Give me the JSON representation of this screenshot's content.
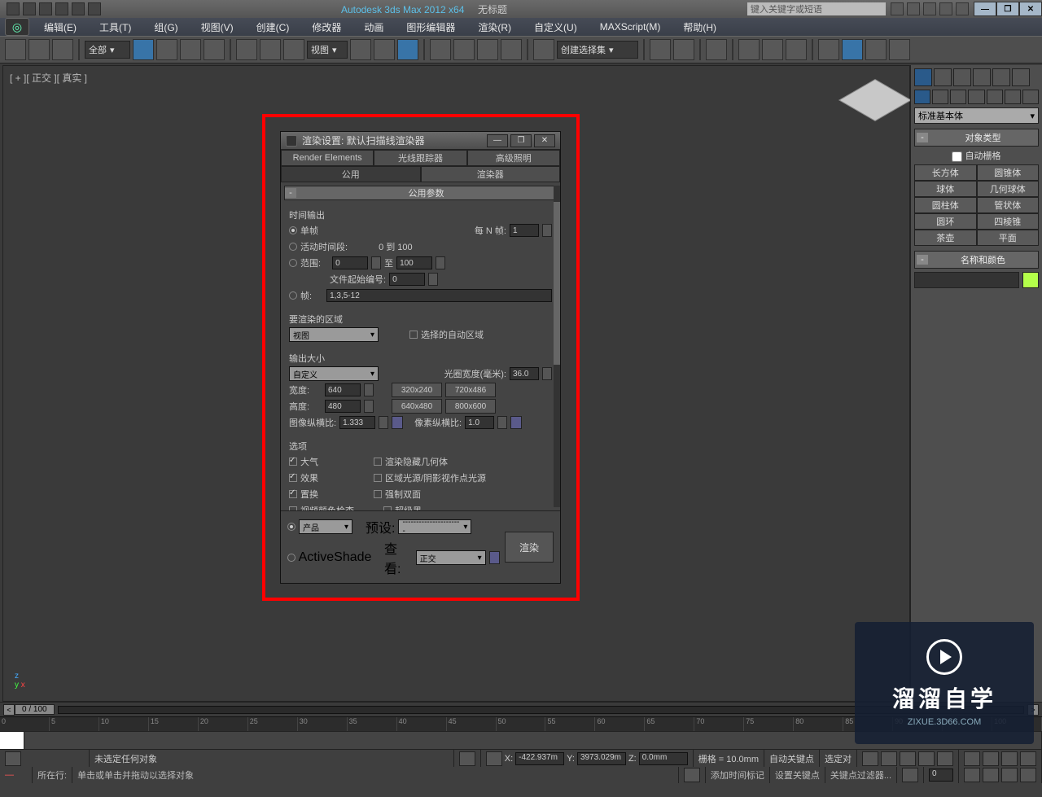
{
  "app": {
    "title_left": "Autodesk 3ds Max 2012 x64",
    "title_right": "无标题",
    "search_placeholder": "键入关键字或短语"
  },
  "menu": {
    "edit": "编辑(E)",
    "tools": "工具(T)",
    "group": "组(G)",
    "views": "视图(V)",
    "create": "创建(C)",
    "modifiers": "修改器",
    "animation": "动画",
    "graph": "图形编辑器",
    "rendering": "渲染(R)",
    "customize": "自定义(U)",
    "maxscript": "MAXScript(M)",
    "help": "帮助(H)"
  },
  "toolbar": {
    "filter_combo": "全部",
    "view_combo": "视图",
    "selset_combo": "创建选择集"
  },
  "viewport": {
    "label": "[ + ][ 正交 ][ 真实 ]"
  },
  "create_panel": {
    "combo": "标准基本体",
    "rollout_type": "对象类型",
    "autogrid": "自动栅格",
    "btns": {
      "box": "长方体",
      "cone": "圆锥体",
      "sphere": "球体",
      "geosphere": "几何球体",
      "cylinder": "圆柱体",
      "tube": "管状体",
      "torus": "圆环",
      "pyramid": "四棱锥",
      "teapot": "茶壶",
      "plane": "平面"
    },
    "rollout_name": "名称和颜色"
  },
  "dialog": {
    "title": "渲染设置: 默认扫描线渲染器",
    "tabs": {
      "render_elements": "Render Elements",
      "raytracer": "光线跟踪器",
      "adv_lighting": "高级照明",
      "common": "公用",
      "renderer": "渲染器"
    },
    "rollout_common": "公用参数",
    "time_output": {
      "label": "时间输出",
      "single": "单帧",
      "every_n": "每 N 帧:",
      "every_n_val": "1",
      "active": "活动时间段:",
      "active_range": "0 到 100",
      "range": "范围:",
      "range_from": "0",
      "range_to_lbl": "至",
      "range_to": "100",
      "file_start": "文件起始编号:",
      "file_start_val": "0",
      "frames": "帧:",
      "frames_val": "1,3,5-12"
    },
    "area": {
      "label": "要渲染的区域",
      "combo": "视图",
      "autoregion": "选择的自动区域"
    },
    "output_size": {
      "label": "输出大小",
      "combo": "自定义",
      "aperture_lbl": "光圈宽度(毫米):",
      "aperture": "36.0",
      "width_lbl": "宽度:",
      "width": "640",
      "height_lbl": "高度:",
      "height": "480",
      "p1": "320x240",
      "p2": "720x486",
      "p3": "640x480",
      "p4": "800x600",
      "img_aspect_lbl": "图像纵横比:",
      "img_aspect": "1.333",
      "pix_aspect_lbl": "像素纵横比:",
      "pix_aspect": "1.0"
    },
    "options": {
      "label": "选项",
      "atmos": "大气",
      "hidden": "渲染隐藏几何体",
      "effects": "效果",
      "area_lights": "区域光源/阴影视作点光源",
      "displace": "置换",
      "force2": "强制双面",
      "video": "视频颜色检查",
      "super": "超级黑"
    },
    "footer": {
      "product": "产品",
      "activeshade": "ActiveShade",
      "preset_lbl": "预设:",
      "preset": "----------------------",
      "view_lbl": "查看:",
      "view": "正交",
      "render": "渲染"
    }
  },
  "timeline": {
    "frame": "0 / 100",
    "ticks": [
      "0",
      "5",
      "10",
      "15",
      "20",
      "25",
      "30",
      "35",
      "40",
      "45",
      "50",
      "55",
      "60",
      "65",
      "70",
      "75",
      "80",
      "85",
      "90",
      "95",
      "100"
    ]
  },
  "status": {
    "none_selected": "未选定任何对象",
    "x_lbl": "X:",
    "x": "-422.937m",
    "y_lbl": "Y:",
    "y": "3973.029m",
    "z_lbl": "Z:",
    "z": "0.0mm",
    "grid": "栅格 = 10.0mm",
    "autokey": "自动关键点",
    "selected": "选定对"
  },
  "prompt": {
    "now": "所在行:",
    "hint": "单击或单击并拖动以选择对象",
    "addtag": "添加时间标记",
    "setkey": "设置关键点",
    "keyfilter": "关键点过滤器..."
  },
  "watermark": {
    "big": "溜溜自学",
    "small": "ZIXUE.3D66.COM"
  }
}
